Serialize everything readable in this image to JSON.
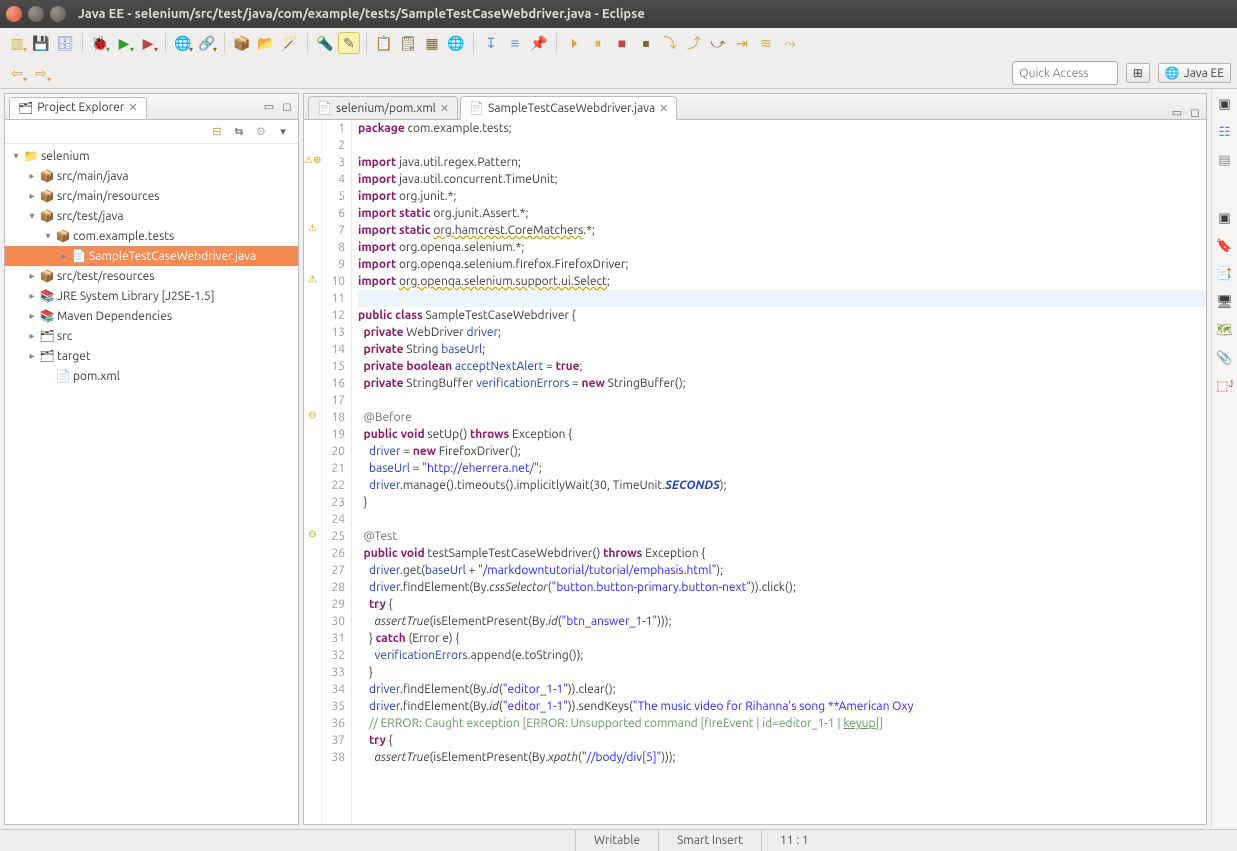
{
  "window": {
    "title": "Java EE - selenium/src/test/java/com/example/tests/SampleTestCaseWebdriver.java - Eclipse"
  },
  "quick_access": "Quick Access",
  "perspective": {
    "label": "Java EE"
  },
  "project_explorer": {
    "title": "Project Explorer",
    "nodes": [
      {
        "label": "selenium",
        "depth": 0,
        "exp": "▾",
        "icon": "📁"
      },
      {
        "label": "src/main/java",
        "depth": 1,
        "exp": "▸",
        "icon": "📦"
      },
      {
        "label": "src/main/resources",
        "depth": 1,
        "exp": "▸",
        "icon": "📦"
      },
      {
        "label": "src/test/java",
        "depth": 1,
        "exp": "▾",
        "icon": "📦"
      },
      {
        "label": "com.example.tests",
        "depth": 2,
        "exp": "▾",
        "icon": "📦"
      },
      {
        "label": "SampleTestCaseWebdriver.java",
        "depth": 3,
        "exp": "▸",
        "icon": "📄",
        "sel": true
      },
      {
        "label": "src/test/resources",
        "depth": 1,
        "exp": "▸",
        "icon": "📦"
      },
      {
        "label": "JRE System Library [J2SE-1.5]",
        "depth": 1,
        "exp": "▸",
        "icon": "📚"
      },
      {
        "label": "Maven Dependencies",
        "depth": 1,
        "exp": "▸",
        "icon": "📚"
      },
      {
        "label": "src",
        "depth": 1,
        "exp": "▸",
        "icon": "🗂"
      },
      {
        "label": "target",
        "depth": 1,
        "exp": "▸",
        "icon": "🗂"
      },
      {
        "label": "pom.xml",
        "depth": 2,
        "exp": "",
        "icon": "📄"
      }
    ]
  },
  "editor_tabs": [
    {
      "label": "selenium/pom.xml",
      "active": false
    },
    {
      "label": "SampleTestCaseWebdriver.java",
      "active": true
    }
  ],
  "code": {
    "lines": [
      {
        "n": 1,
        "m": "",
        "h": "<span class='kw'>package</span> com.example.tests;"
      },
      {
        "n": 2,
        "m": "",
        "h": ""
      },
      {
        "n": 3,
        "m": "⚠⊕",
        "h": "<span class='kw'>import</span> java.util.regex.Pattern;"
      },
      {
        "n": 4,
        "m": "",
        "h": "<span class='kw'>import</span> java.util.concurrent.TimeUnit;"
      },
      {
        "n": 5,
        "m": "",
        "h": "<span class='kw'>import</span> org.junit.*;"
      },
      {
        "n": 6,
        "m": "",
        "h": "<span class='kw'>import static</span> org.junit.Assert.*;"
      },
      {
        "n": 7,
        "m": "⚠",
        "h": "<span class='kw'>import static</span> <span style='text-decoration:underline wavy #caa500'>org.hamcrest.CoreMatchers</span>.*;"
      },
      {
        "n": 8,
        "m": "",
        "h": "<span class='kw'>import</span> org.openqa.selenium.*;"
      },
      {
        "n": 9,
        "m": "",
        "h": "<span class='kw'>import</span> org.openqa.selenium.firefox.FirefoxDriver;"
      },
      {
        "n": 10,
        "m": "⚠",
        "h": "<span class='kw'>import</span> <span style='text-decoration:underline wavy #caa500'>org.openqa.selenium.support.ui.Select</span>;"
      },
      {
        "n": 11,
        "m": "",
        "h": "",
        "hl": true
      },
      {
        "n": 12,
        "m": "",
        "h": "<span class='kw'>public class</span> SampleTestCaseWebdriver {"
      },
      {
        "n": 13,
        "m": "",
        "h": "  <span class='kw'>private</span> WebDriver <span class='fld'>driver</span>;"
      },
      {
        "n": 14,
        "m": "",
        "h": "  <span class='kw'>private</span> String <span class='fld'>baseUrl</span>;"
      },
      {
        "n": 15,
        "m": "",
        "h": "  <span class='kw'>private boolean</span> <span class='fld'>acceptNextAlert</span> = <span class='kw'>true</span>;"
      },
      {
        "n": 16,
        "m": "",
        "h": "  <span class='kw'>private</span> StringBuffer <span class='fld'>verificationErrors</span> = <span class='kw'>new</span> StringBuffer();"
      },
      {
        "n": 17,
        "m": "",
        "h": ""
      },
      {
        "n": 18,
        "m": "⊖",
        "h": "  <span class='an'>@Before</span>"
      },
      {
        "n": 19,
        "m": "",
        "h": "  <span class='kw'>public void</span> setUp() <span class='kw'>throws</span> Exception {"
      },
      {
        "n": 20,
        "m": "",
        "h": "    <span class='fld'>driver</span> = <span class='kw'>new</span> FirefoxDriver();"
      },
      {
        "n": 21,
        "m": "",
        "h": "    <span class='fld'>baseUrl</span> = <span class='str'>\"http://eherrera.net/\"</span>;"
      },
      {
        "n": 22,
        "m": "",
        "h": "    <span class='fld'>driver</span>.manage().timeouts().implicitlyWait(30, TimeUnit.<span class='sc'>SECONDS</span>);"
      },
      {
        "n": 23,
        "m": "",
        "h": "  }"
      },
      {
        "n": 24,
        "m": "",
        "h": ""
      },
      {
        "n": 25,
        "m": "⊖",
        "h": "  <span class='an'>@Test</span>"
      },
      {
        "n": 26,
        "m": "",
        "h": "  <span class='kw'>public void</span> testSampleTestCaseWebdriver() <span class='kw'>throws</span> Exception {"
      },
      {
        "n": 27,
        "m": "",
        "h": "    <span class='fld'>driver</span>.get(<span class='fld'>baseUrl</span> + <span class='str'>\"/markdowntutorial/tutorial/emphasis.html\"</span>);"
      },
      {
        "n": 28,
        "m": "",
        "h": "    <span class='fld'>driver</span>.findElement(By.<span class='mth'>cssSelector</span>(<span class='str'>\"button.button-primary.button-next\"</span>)).click();"
      },
      {
        "n": 29,
        "m": "",
        "h": "    <span class='kw'>try</span> {"
      },
      {
        "n": 30,
        "m": "",
        "h": "      <span class='mth'>assertTrue</span>(isElementPresent(By.<span class='mth'>id</span>(<span class='str'>\"btn_answer_1-1\"</span>)));"
      },
      {
        "n": 31,
        "m": "",
        "h": "    } <span class='kw'>catch</span> (Error e) {"
      },
      {
        "n": 32,
        "m": "",
        "h": "      <span class='fld'>verificationErrors</span>.append(e.toString());"
      },
      {
        "n": 33,
        "m": "",
        "h": "    }"
      },
      {
        "n": 34,
        "m": "",
        "h": "    <span class='fld'>driver</span>.findElement(By.<span class='mth'>id</span>(<span class='str'>\"editor_1-1\"</span>)).clear();"
      },
      {
        "n": 35,
        "m": "",
        "h": "    <span class='fld'>driver</span>.findElement(By.<span class='mth'>id</span>(<span class='str'>\"editor_1-1\"</span>)).sendKeys(<span class='str'>\"The music video for Rihanna's song **American Oxy</span>"
      },
      {
        "n": 36,
        "m": "",
        "h": "    <span class='cm'>// ERROR: Caught exception [ERROR: Unsupported command [fireEvent | id=editor_1-1 | <u>keyup</u>]]</span>"
      },
      {
        "n": 37,
        "m": "",
        "h": "    <span class='kw'>try</span> {"
      },
      {
        "n": 38,
        "m": "",
        "h": "      <span class='mth'>assertTrue</span>(isElementPresent(By.<span class='mth'>xpath</span>(<span class='str'>\"//body/div[5]\"</span>)));"
      }
    ]
  },
  "status": {
    "writable": "Writable",
    "insert": "Smart Insert",
    "pos": "11 : 1"
  }
}
